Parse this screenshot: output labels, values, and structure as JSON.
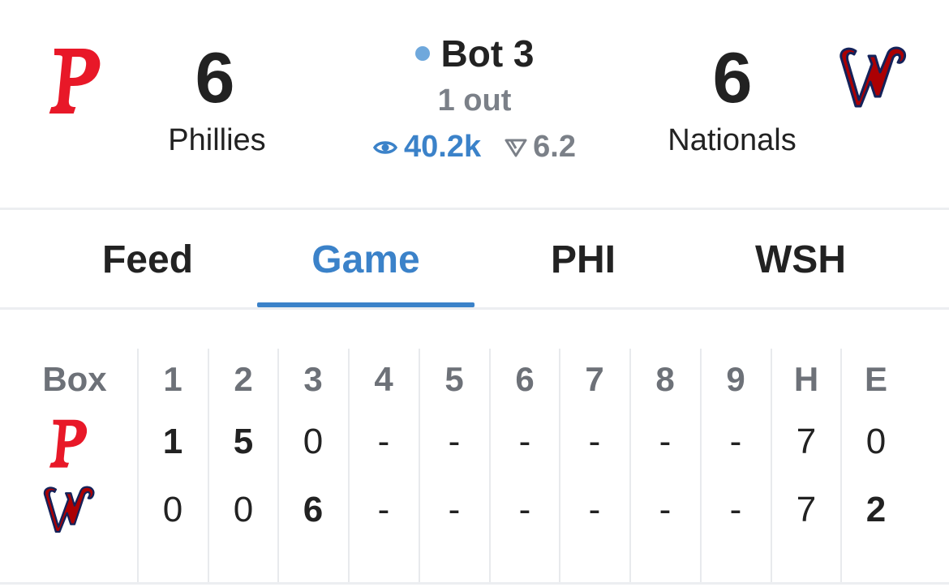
{
  "away": {
    "name": "Phillies",
    "score": "6",
    "abbr": "PHI",
    "color": "#e81828"
  },
  "home": {
    "name": "Nationals",
    "score": "6",
    "abbr": "WSH",
    "color": "#ab0003"
  },
  "status": {
    "inning": "Bot 3",
    "outs": "1 out",
    "viewers": "40.2k",
    "rating": "6.2",
    "live_dot_color": "#6fa8dc"
  },
  "tabs": [
    {
      "label": "Feed",
      "active": false
    },
    {
      "label": "Game",
      "active": true
    },
    {
      "label": "PHI",
      "active": false
    },
    {
      "label": "WSH",
      "active": false
    }
  ],
  "box_score": {
    "header": [
      "Box",
      "1",
      "2",
      "3",
      "4",
      "5",
      "6",
      "7",
      "8",
      "9",
      "H",
      "E"
    ],
    "rows": [
      {
        "team": "PHI",
        "cells": [
          "1",
          "5",
          "0",
          "-",
          "-",
          "-",
          "-",
          "-",
          "-",
          "7",
          "0"
        ],
        "bold": [
          true,
          true,
          false,
          false,
          false,
          false,
          false,
          false,
          false,
          false,
          false
        ]
      },
      {
        "team": "WSH",
        "cells": [
          "0",
          "0",
          "6",
          "-",
          "-",
          "-",
          "-",
          "-",
          "-",
          "7",
          "2"
        ],
        "bold": [
          false,
          false,
          true,
          false,
          false,
          false,
          false,
          false,
          false,
          false,
          true
        ]
      }
    ]
  },
  "icons": {
    "viewers": "eye-icon",
    "rating": "down-arrow-icon",
    "away_logo": "phillies-logo",
    "home_logo": "nationals-logo"
  },
  "colors": {
    "accent": "#3b82c9",
    "muted": "#7b8088",
    "divider": "#eceef1"
  }
}
